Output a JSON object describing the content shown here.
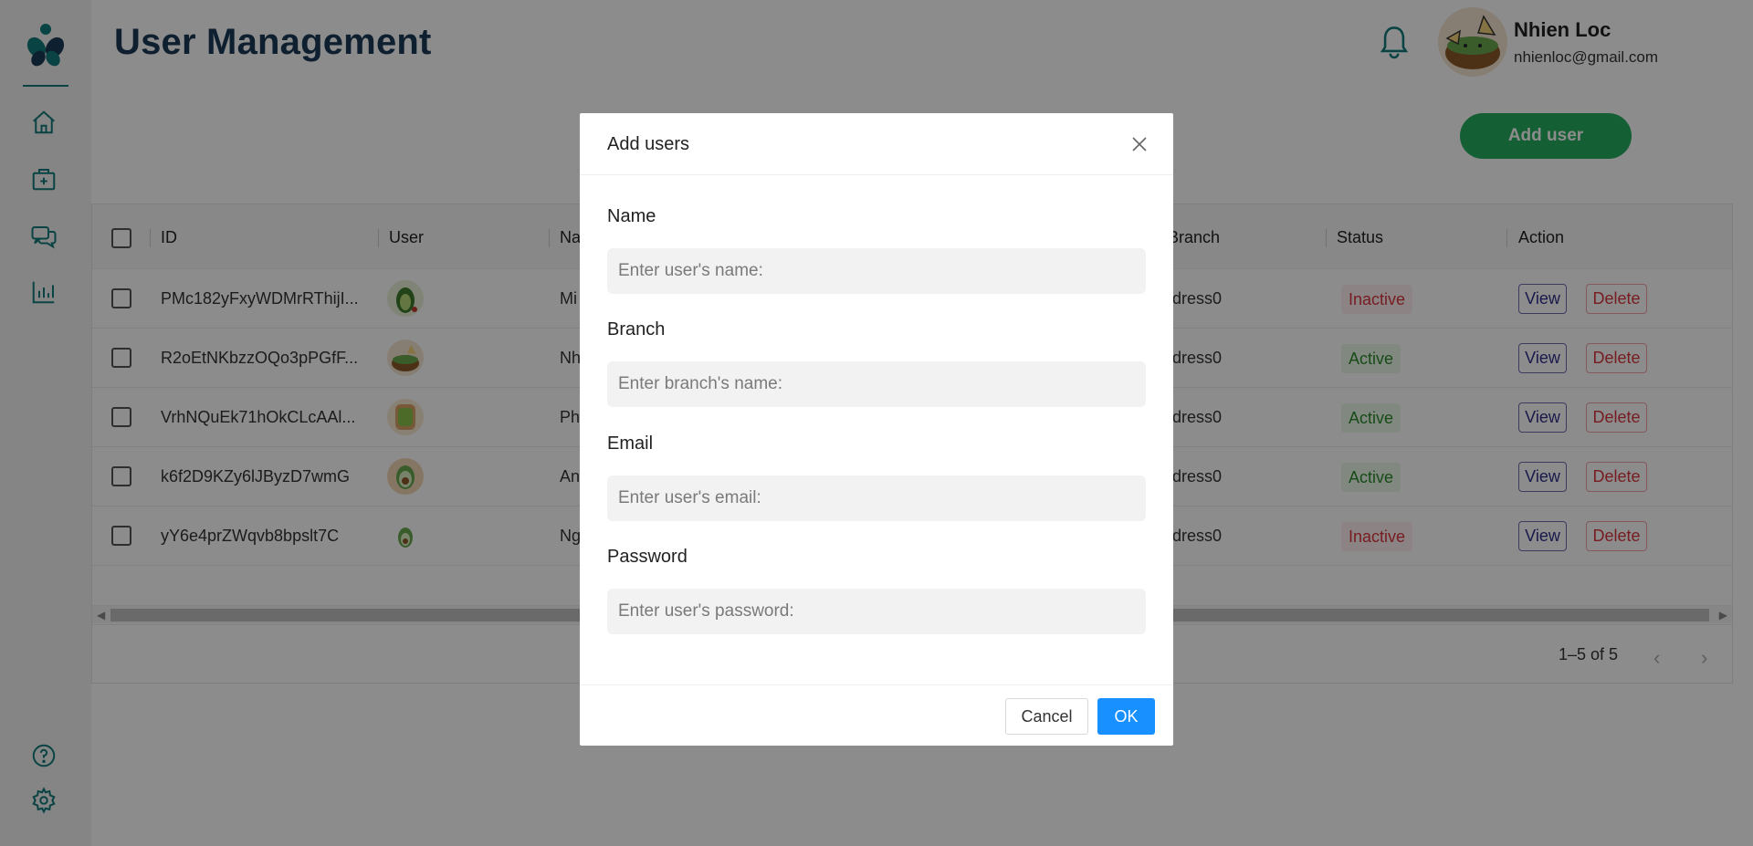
{
  "header": {
    "title": "User Management",
    "user_name": "Nhien Loc",
    "user_email": "nhienloc@gmail.com",
    "add_user_label": "Add user"
  },
  "sidebar": {
    "items": [
      {
        "icon": "home-icon"
      },
      {
        "icon": "hospital-icon"
      },
      {
        "icon": "chat-icon"
      },
      {
        "icon": "analytics-icon"
      }
    ],
    "bottom": [
      {
        "icon": "help-icon"
      },
      {
        "icon": "settings-icon"
      }
    ]
  },
  "table": {
    "columns": [
      "ID",
      "User",
      "Na",
      "Branch",
      "Status",
      "Action"
    ],
    "rows": [
      {
        "id": "PMc182yFxyWDMrRThijI...",
        "name": "Mi",
        "branch": "ddress0",
        "status": "Inactive"
      },
      {
        "id": "R2oEtNKbzzOQo3pPGfF...",
        "name": "Nh",
        "branch": "ddress0",
        "status": "Active"
      },
      {
        "id": "VrhNQuEk71hOkCLcAAl...",
        "name": "Ph",
        "branch": "ddress0",
        "status": "Active"
      },
      {
        "id": "k6f2D9KZy6lJByzD7wmG",
        "name": "An",
        "branch": "ddress0",
        "status": "Active"
      },
      {
        "id": "yY6e4prZWqvb8bpslt7C",
        "name": "Ng",
        "branch": "ddress0",
        "status": "Inactive"
      }
    ],
    "view_label": "View",
    "delete_label": "Delete",
    "pagination": "1–5 of 5"
  },
  "modal": {
    "title": "Add users",
    "fields": [
      {
        "label": "Name",
        "placeholder": "Enter user's name:"
      },
      {
        "label": "Branch",
        "placeholder": "Enter branch's name:"
      },
      {
        "label": "Email",
        "placeholder": "Enter user's email:"
      },
      {
        "label": "Password",
        "placeholder": "Enter user's password:"
      }
    ],
    "cancel_label": "Cancel",
    "ok_label": "OK"
  },
  "colors": {
    "brand": "#137a7a",
    "add_button": "#27ad5f",
    "primary": "#1890ff",
    "title": "#1b3a57"
  }
}
